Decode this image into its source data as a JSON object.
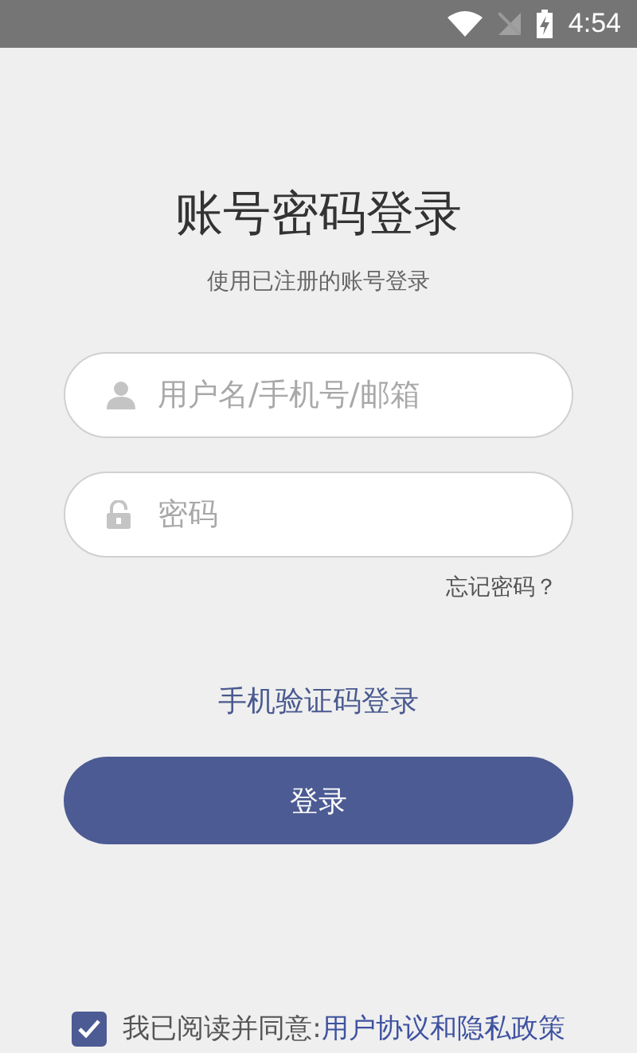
{
  "status_bar": {
    "time": "4:54"
  },
  "title": "账号密码登录",
  "subtitle": "使用已注册的账号登录",
  "fields": [
    {
      "kind": "user",
      "placeholder": "用户名/手机号/邮箱"
    },
    {
      "kind": "password",
      "placeholder": "密码"
    }
  ],
  "forgot_password": "忘记密码？",
  "sms_login": "手机验证码登录",
  "login_button": "登录",
  "agreement": {
    "checked": true,
    "text": "我已阅读并同意:",
    "terms": "用户协议",
    "and": "和",
    "privacy": "隐私政策"
  }
}
